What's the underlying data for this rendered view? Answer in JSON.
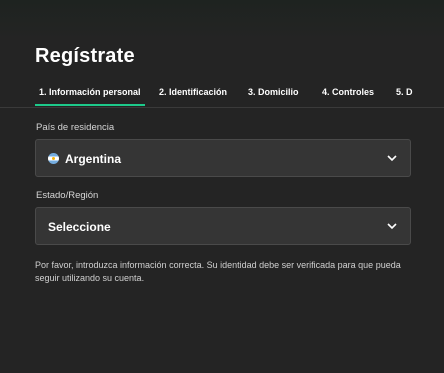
{
  "page": {
    "title": "Regístrate"
  },
  "tabs": [
    {
      "label": "1. Información personal",
      "active": true
    },
    {
      "label": "2. Identificación"
    },
    {
      "label": "3. Domicilio"
    },
    {
      "label": "4. Controles"
    },
    {
      "label": "5. D"
    }
  ],
  "form": {
    "country": {
      "label": "País de residencia",
      "value": "Argentina",
      "flag_icon": "argentina-flag-icon"
    },
    "region": {
      "label": "Estado/Región",
      "value": "Seleccione"
    }
  },
  "notice": "Por favor, introduzca información correcta. Su identidad debe ser verificada para que pueda seguir utilizando su cuenta.",
  "colors": {
    "accent": "#1dc98a",
    "background": "#242424",
    "field": "#353535"
  }
}
